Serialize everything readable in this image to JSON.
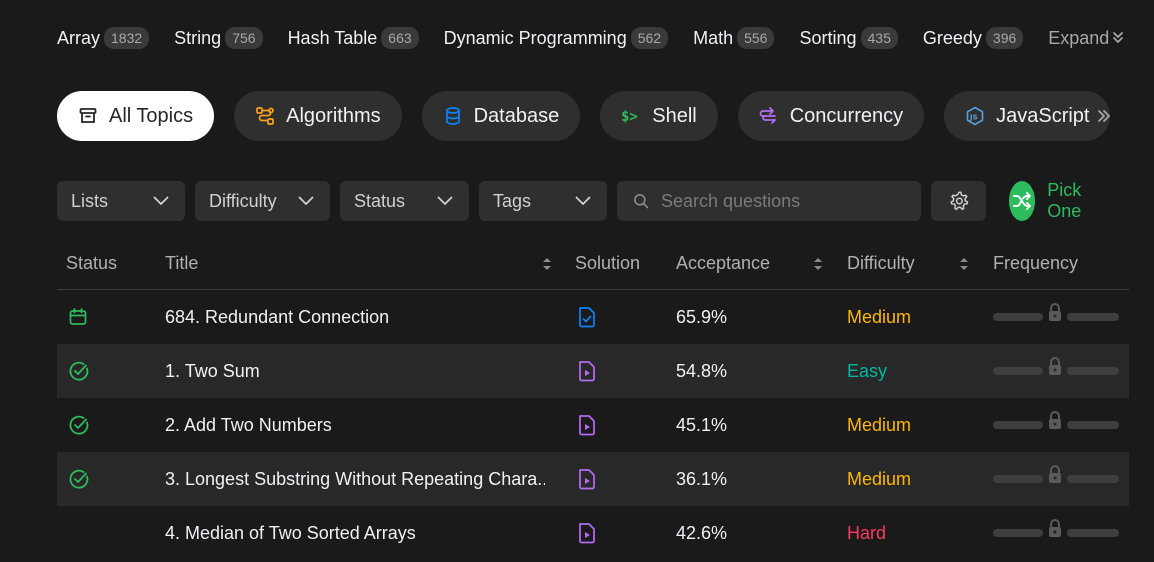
{
  "topic_tags": [
    {
      "name": "Array",
      "count": "1832"
    },
    {
      "name": "String",
      "count": "756"
    },
    {
      "name": "Hash Table",
      "count": "663"
    },
    {
      "name": "Dynamic Programming",
      "count": "562"
    },
    {
      "name": "Math",
      "count": "556"
    },
    {
      "name": "Sorting",
      "count": "435"
    },
    {
      "name": "Greedy",
      "count": "396"
    }
  ],
  "expand_label": "Expand",
  "categories": [
    {
      "label": "All Topics",
      "icon": "inbox-icon",
      "active": true
    },
    {
      "label": "Algorithms",
      "icon": "algorithm-icon",
      "color": "#ffa116"
    },
    {
      "label": "Database",
      "icon": "database-icon",
      "color": "#0a84ff"
    },
    {
      "label": "Shell",
      "icon": "terminal-icon",
      "color": "#2cbb5d"
    },
    {
      "label": "Concurrency",
      "icon": "concurrency-icon",
      "color": "#b56cf2"
    },
    {
      "label": "JavaScript",
      "icon": "nodejs-icon",
      "color": "#5aa0e0"
    }
  ],
  "filters": {
    "lists": "Lists",
    "difficulty": "Difficulty",
    "status": "Status",
    "tags": "Tags",
    "search_placeholder": "Search questions",
    "pick_one": "Pick One"
  },
  "table": {
    "headers": {
      "status": "Status",
      "title": "Title",
      "solution": "Solution",
      "acceptance": "Acceptance",
      "difficulty": "Difficulty",
      "frequency": "Frequency"
    },
    "rows": [
      {
        "status": "daily",
        "title": "684. Redundant Connection",
        "solution": "article",
        "acceptance": "65.9%",
        "difficulty": "Medium"
      },
      {
        "status": "solved",
        "title": "1. Two Sum",
        "solution": "video",
        "acceptance": "54.8%",
        "difficulty": "Easy"
      },
      {
        "status": "solved",
        "title": "2. Add Two Numbers",
        "solution": "video",
        "acceptance": "45.1%",
        "difficulty": "Medium"
      },
      {
        "status": "solved",
        "title": "3. Longest Substring Without Repeating Chara...",
        "solution": "video",
        "acceptance": "36.1%",
        "difficulty": "Medium"
      },
      {
        "status": "none",
        "title": "4. Median of Two Sorted Arrays",
        "solution": "video",
        "acceptance": "42.6%",
        "difficulty": "Hard"
      }
    ]
  },
  "colors": {
    "easy": "#00b8a3",
    "medium": "#ffb800",
    "hard": "#ff375f",
    "accent_green": "#2cbb5d",
    "solution_article": "#0a84ff",
    "solution_video": "#b56cf2"
  }
}
